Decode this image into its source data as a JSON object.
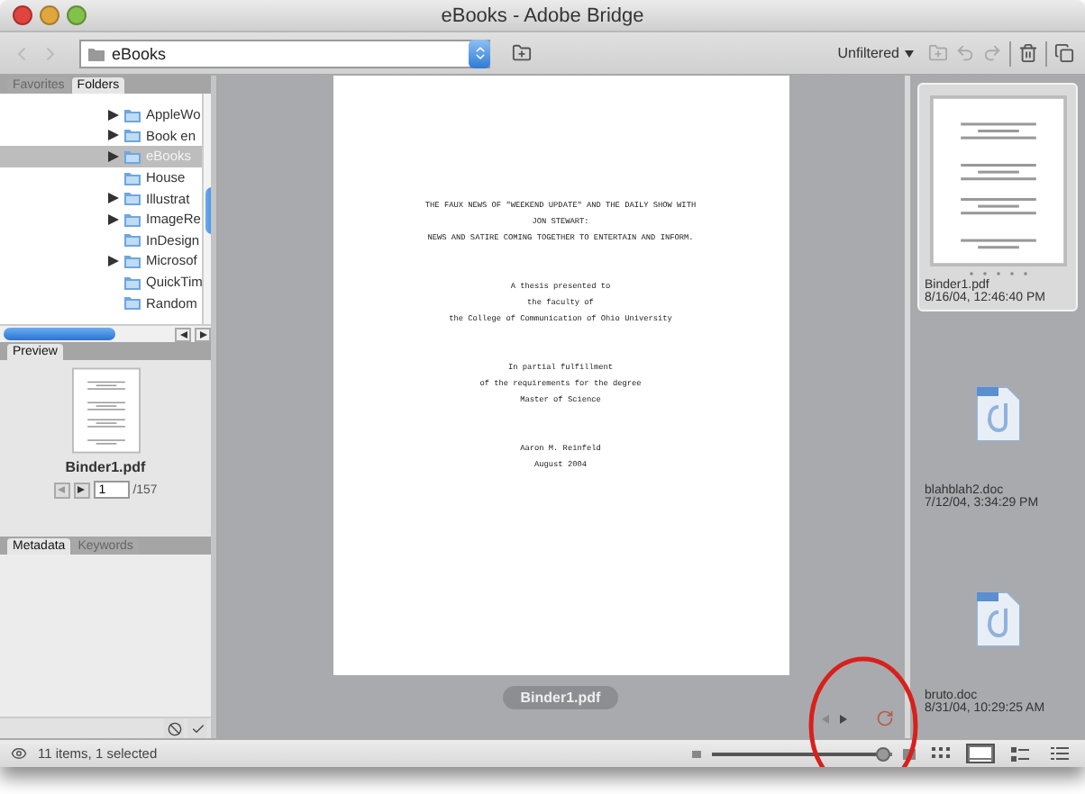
{
  "window": {
    "title": "eBooks - Adobe Bridge"
  },
  "toolbar": {
    "path": "eBooks",
    "filter": "Unfiltered"
  },
  "folders_panel": {
    "tabs": [
      {
        "label": "Favorites",
        "selected": false
      },
      {
        "label": "Folders",
        "selected": true
      }
    ],
    "items": [
      {
        "label": "AppleWo",
        "has_children": true,
        "selected": false
      },
      {
        "label": "Book en",
        "has_children": true,
        "selected": false
      },
      {
        "label": "eBooks",
        "has_children": true,
        "selected": true
      },
      {
        "label": "House",
        "has_children": false,
        "selected": false
      },
      {
        "label": "Illustrat",
        "has_children": true,
        "selected": false
      },
      {
        "label": "ImageRe",
        "has_children": true,
        "selected": false
      },
      {
        "label": "InDesign",
        "has_children": false,
        "selected": false
      },
      {
        "label": "Microsof",
        "has_children": true,
        "selected": false
      },
      {
        "label": "QuickTim",
        "has_children": false,
        "selected": false
      },
      {
        "label": "Random",
        "has_children": false,
        "selected": false
      }
    ]
  },
  "preview_panel": {
    "tabs": [
      {
        "label": "Preview",
        "selected": true
      }
    ],
    "file_name": "Binder1.pdf",
    "page": "1",
    "page_count": "/157"
  },
  "metadata_panel": {
    "tabs": [
      {
        "label": "Metadata",
        "selected": true
      },
      {
        "label": "Keywords",
        "selected": false
      }
    ]
  },
  "document": {
    "blocks": [
      [
        "THE FAUX NEWS OF \"WEEKEND UPDATE\" AND THE DAILY SHOW WITH",
        "JON STEWART:",
        "NEWS AND SATIRE COMING TOGETHER TO ENTERTAIN AND INFORM."
      ],
      [
        "A thesis presented to",
        "the faculty of",
        "the College of Communication of Ohio University"
      ],
      [
        "In partial fulfillment",
        "of the requirements for the degree",
        "Master of Science"
      ],
      [
        "Aaron M. Reinfeld",
        "August 2004"
      ]
    ],
    "caption": "Binder1.pdf"
  },
  "thumbnails": [
    {
      "kind": "pdf",
      "name": "Binder1.pdf",
      "date": "8/16/04, 12:46:40 PM",
      "selected": true
    },
    {
      "kind": "doc",
      "name": "blahblah2.doc",
      "date": "7/12/04, 3:34:29 PM",
      "selected": false
    },
    {
      "kind": "doc",
      "name": "bruto.doc",
      "date": "8/31/04, 10:29:25 AM",
      "selected": false
    }
  ],
  "status_bar": {
    "text": "11 items, 1 selected",
    "thumbnail_size": {
      "level": 0.95
    },
    "views": [
      {
        "kind": "grid",
        "selected": false
      },
      {
        "kind": "filmstrip",
        "selected": true
      },
      {
        "kind": "details",
        "selected": false
      },
      {
        "kind": "list",
        "selected": false
      }
    ]
  }
}
